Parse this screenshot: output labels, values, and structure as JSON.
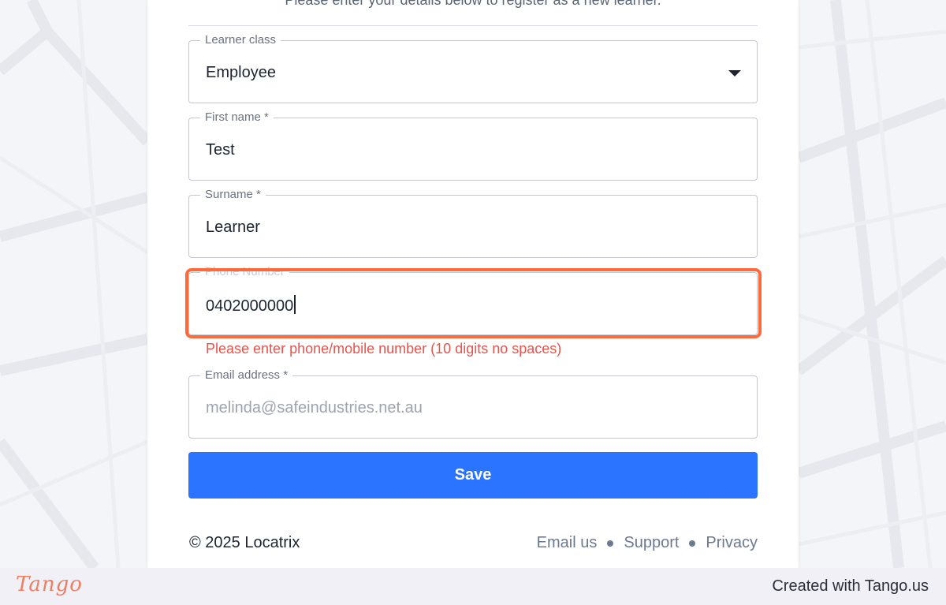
{
  "form": {
    "intro": "Please enter your details below to register as a new learner.",
    "learner_class": {
      "label": "Learner class",
      "value": "Employee"
    },
    "first_name": {
      "label": "First name *",
      "value": "Test"
    },
    "surname": {
      "label": "Surname *",
      "value": "Learner"
    },
    "phone": {
      "label": "Phone Number",
      "value": "0402000000",
      "error": "Please enter phone/mobile number (10 digits no spaces)"
    },
    "email": {
      "label": "Email address *",
      "placeholder": "melinda@safeindustries.net.au"
    },
    "save_label": "Save"
  },
  "footer": {
    "copyright": "© 2025 Locatrix",
    "links": [
      "Email us",
      "Support",
      "Privacy"
    ]
  },
  "tango": {
    "logo": "Tango",
    "credit": "Created with Tango.us"
  },
  "colors": {
    "accent": "#2a74ff",
    "highlight": "#ff6a3d",
    "error": "#e8534b"
  }
}
